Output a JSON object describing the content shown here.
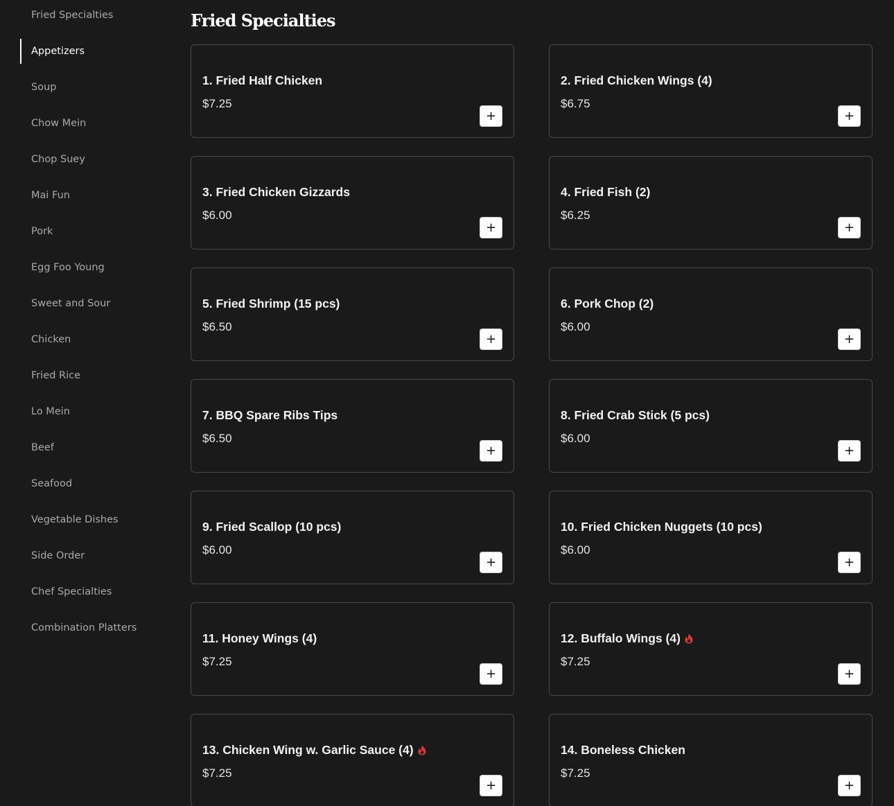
{
  "sidebar": {
    "items": [
      {
        "label": "Fried Specialties"
      },
      {
        "label": "Appetizers"
      },
      {
        "label": "Soup"
      },
      {
        "label": "Chow Mein"
      },
      {
        "label": "Chop Suey"
      },
      {
        "label": "Mai Fun"
      },
      {
        "label": "Pork"
      },
      {
        "label": "Egg Foo Young"
      },
      {
        "label": "Sweet and Sour"
      },
      {
        "label": "Chicken"
      },
      {
        "label": "Fried Rice"
      },
      {
        "label": "Lo Mein"
      },
      {
        "label": "Beef"
      },
      {
        "label": "Seafood"
      },
      {
        "label": "Vegetable Dishes"
      },
      {
        "label": "Side Order"
      },
      {
        "label": "Chef Specialties"
      },
      {
        "label": "Combination Platters"
      }
    ],
    "active_label": "Appetizers"
  },
  "section": {
    "title": "Fried Specialties"
  },
  "items": [
    {
      "name": "1. Fried Half Chicken",
      "price": "$7.25",
      "spicy": false
    },
    {
      "name": "2. Fried Chicken Wings (4)",
      "price": "$6.75",
      "spicy": false
    },
    {
      "name": "3. Fried Chicken Gizzards",
      "price": "$6.00",
      "spicy": false
    },
    {
      "name": "4. Fried Fish (2)",
      "price": "$6.25",
      "spicy": false
    },
    {
      "name": "5. Fried Shrimp (15 pcs)",
      "price": "$6.50",
      "spicy": false
    },
    {
      "name": "6. Pork Chop (2)",
      "price": "$6.00",
      "spicy": false
    },
    {
      "name": "7. BBQ Spare Ribs Tips",
      "price": "$6.50",
      "spicy": false
    },
    {
      "name": "8. Fried Crab Stick (5 pcs)",
      "price": "$6.00",
      "spicy": false
    },
    {
      "name": "9. Fried Scallop (10 pcs)",
      "price": "$6.00",
      "spicy": false
    },
    {
      "name": "10. Fried Chicken Nuggets (10 pcs)",
      "price": "$6.00",
      "spicy": false
    },
    {
      "name": "11. Honey Wings (4)",
      "price": "$7.25",
      "spicy": false
    },
    {
      "name": "12. Buffalo Wings (4)",
      "price": "$7.25",
      "spicy": true
    },
    {
      "name": "13. Chicken Wing w. Garlic Sauce (4)",
      "price": "$7.25",
      "spicy": true
    },
    {
      "name": "14. Boneless Chicken",
      "price": "$7.25",
      "spicy": false
    }
  ],
  "add_button": {
    "label": "+"
  },
  "icons": {
    "spicy": "flame-icon",
    "add": "plus-icon"
  },
  "colors": {
    "background": "#1b1a1b",
    "card_border": "#4a494a",
    "spicy": "#d9393b",
    "text": "#f2f2f2",
    "muted_text": "#a9a9a9"
  }
}
